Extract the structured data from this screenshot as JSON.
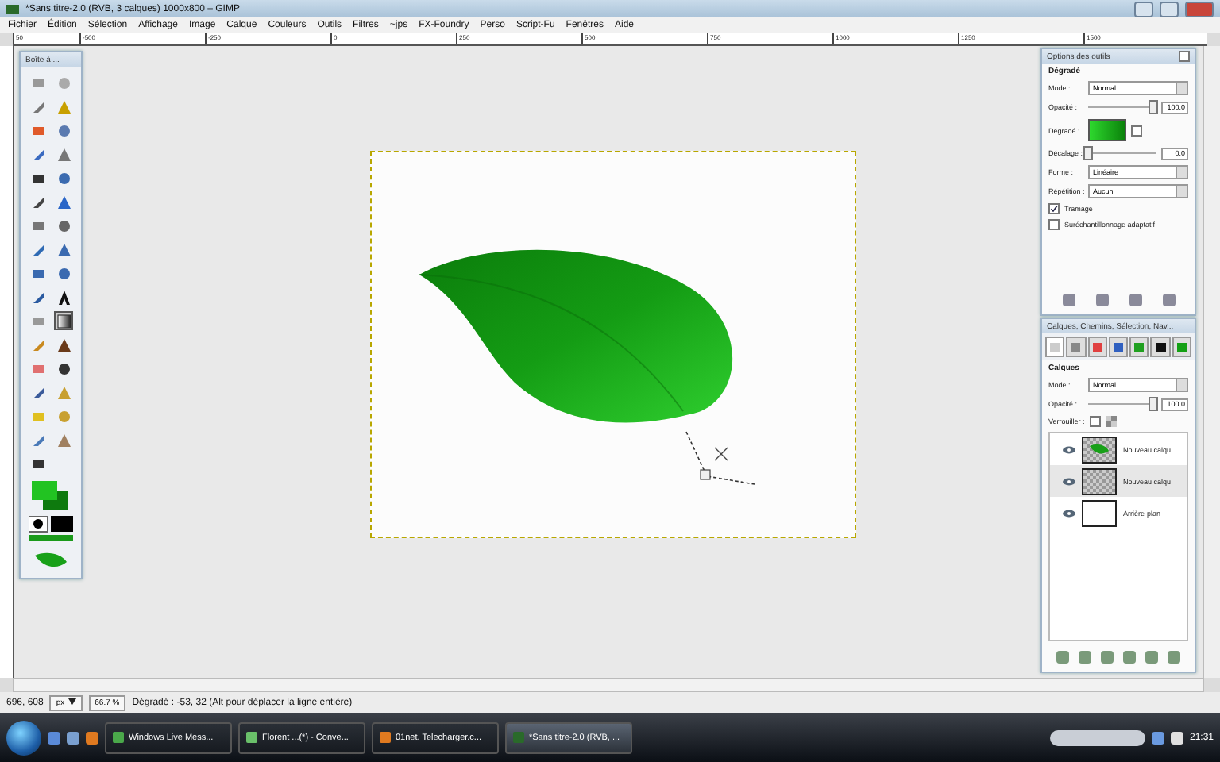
{
  "window": {
    "title": "*Sans titre-2.0 (RVB, 3 calques) 1000x800 – GIMP"
  },
  "menu": [
    "Fichier",
    "Édition",
    "Sélection",
    "Affichage",
    "Image",
    "Calque",
    "Couleurs",
    "Outils",
    "Filtres",
    "~jps",
    "FX-Foundry",
    "Perso",
    "Script-Fu",
    "Fenêtres",
    "Aide"
  ],
  "ruler": {
    "labels": [
      "50",
      "-500",
      "-250",
      "0",
      "250",
      "500",
      "750",
      "1000",
      "1250",
      "1500"
    ]
  },
  "toolbox": {
    "title": "Boîte à ...",
    "tools": [
      {
        "selected": false
      },
      {
        "selected": false
      },
      {
        "selected": false
      },
      {
        "selected": false
      },
      {
        "selected": false
      },
      {
        "selected": false
      },
      {
        "selected": false
      },
      {
        "selected": false
      },
      {
        "selected": false
      },
      {
        "selected": false
      },
      {
        "selected": false
      },
      {
        "selected": false
      },
      {
        "selected": false
      },
      {
        "selected": false
      },
      {
        "selected": false
      },
      {
        "selected": false
      },
      {
        "selected": false
      },
      {
        "selected": false
      },
      {
        "selected": false
      },
      {
        "selected": false
      },
      {
        "selected": false
      },
      {
        "selected": true
      },
      {
        "selected": false
      },
      {
        "selected": false
      },
      {
        "selected": false
      },
      {
        "selected": false
      },
      {
        "selected": false
      },
      {
        "selected": false
      },
      {
        "selected": false
      },
      {
        "selected": false
      },
      {
        "selected": false
      },
      {
        "selected": false
      },
      {
        "selected": false
      }
    ],
    "foreground": {
      "color": "#22c322"
    },
    "background": {
      "color": "#0e7a0e"
    }
  },
  "tool_options": {
    "title": "Options des outils",
    "section": "Dégradé",
    "mode": {
      "label": "Mode :",
      "value": "Normal"
    },
    "opacity": {
      "label": "Opacité :",
      "level": 0.95,
      "reading": "100.0"
    },
    "gradient": {
      "label": "Dégradé :",
      "reversed": false
    },
    "offset": {
      "label": "Décalage :",
      "level": 0,
      "reading": "0.0"
    },
    "shape": {
      "label": "Forme :",
      "value": "Linéaire"
    },
    "repeat": {
      "label": "Répétition :",
      "value": "Aucun"
    },
    "checks": [
      {
        "label": "Tramage",
        "checked": true
      },
      {
        "label": "Suréchantillonnage adaptatif",
        "checked": false
      }
    ]
  },
  "layers_dock": {
    "title": "Calques, Chemins, Sélection, Nav...",
    "tabs": [
      {
        "selected": true
      },
      {
        "selected": false
      },
      {
        "selected": false
      },
      {
        "selected": false
      },
      {
        "selected": false
      },
      {
        "selected": false
      },
      {
        "selected": false
      }
    ],
    "section": "Calques",
    "mode": {
      "label": "Mode :",
      "value": "Normal"
    },
    "opacity": {
      "label": "Opacité :",
      "level": 0.95,
      "reading": "100.0"
    },
    "lock": {
      "label": "Verrouiller :",
      "checked": false
    },
    "layers": [
      {
        "name": "Nouveau calqu",
        "kind": "leaf",
        "selected": false
      },
      {
        "name": "Nouveau calqu",
        "kind": "transparent",
        "selected": true
      },
      {
        "name": "Arrière-plan",
        "kind": "white",
        "selected": false
      }
    ]
  },
  "status_bar": {
    "pointer": "696, 608",
    "unit": "px",
    "zoom": "66.7 %",
    "message": "Dégradé : -53, 32 (Alt pour déplacer la ligne entière)"
  },
  "taskbar": {
    "tasks": [
      {
        "label": "Windows Live Mess...",
        "selected": false
      },
      {
        "label": "Florent ...(*) - Conve...",
        "selected": false
      },
      {
        "label": "01net. Telecharger.c...",
        "selected": false
      },
      {
        "label": "*Sans titre-2.0 (RVB, ...",
        "selected": true
      }
    ],
    "clock": "21:31"
  }
}
